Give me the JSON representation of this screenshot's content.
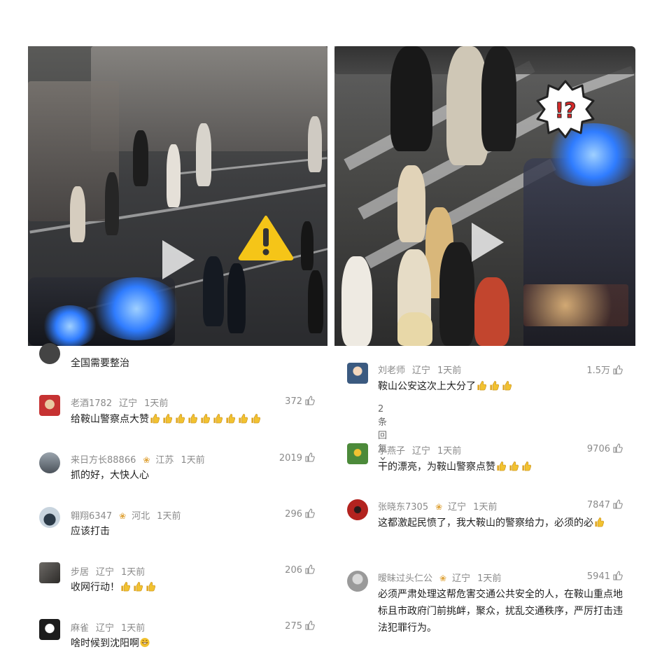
{
  "left_comments": [
    {
      "name": "",
      "location": "",
      "time": "",
      "text": "全国需要整治",
      "likes": "",
      "thumbs": 0
    },
    {
      "name": "老酒1782",
      "location": "辽宁",
      "time": "1天前",
      "text": "给鞍山警察点大赞",
      "likes": "372",
      "thumbs": 9
    },
    {
      "name": "来日方长88866",
      "location": "江苏",
      "time": "1天前",
      "text": "抓的好，大快人心",
      "likes": "2019",
      "thumbs": 0,
      "verified": true
    },
    {
      "name": "翱翔6347",
      "location": "河北",
      "time": "1天前",
      "text": "应该打击",
      "likes": "296",
      "thumbs": 0,
      "verified": true
    },
    {
      "name": "步居",
      "location": "辽宁",
      "time": "1天前",
      "text": "收网行动！",
      "likes": "206",
      "thumbs": 3
    },
    {
      "name": "麻雀",
      "location": "辽宁",
      "time": "1天前",
      "text": "啥时候到沈阳啊",
      "likes": "275",
      "thumbs": 0,
      "grin": true
    }
  ],
  "right_comments": [
    {
      "name": "刘老师",
      "location": "辽宁",
      "time": "1天前",
      "text": "鞍山公安这次上大分了",
      "likes": "1.5万",
      "thumbs": 3,
      "replies": "2条回复"
    },
    {
      "name": "小燕子",
      "location": "辽宁",
      "time": "1天前",
      "text": "干的漂亮，为鞍山警察点赞",
      "likes": "9706",
      "thumbs": 3
    },
    {
      "name": "张晓东7305",
      "location": "辽宁",
      "time": "1天前",
      "text": "这都激起民愤了，我大鞍山的警察给力，必须的必",
      "likes": "7847",
      "thumbs": 1,
      "verified": true
    },
    {
      "name": "暧昧过头仁公",
      "location": "辽宁",
      "time": "1天前",
      "text": "必须严肃处理这帮危害交通公共安全的人，在鞍山重点地标且市政府门前挑衅，聚众，扰乱交通秩序，严厉打击违法犯罪行为。",
      "likes": "5941",
      "thumbs": 0,
      "verified": true
    }
  ],
  "icons": {
    "like": "thumbs-up-icon",
    "play": "play-icon",
    "warning": "warning-icon",
    "exclaim": "shock-exclaim-icon",
    "chevron": "chevron-down-icon"
  },
  "colors": {
    "warning": "#f5c518",
    "thumb_emoji": "#f2c230",
    "verified": "#e0a640",
    "meta": "#8a8a8a"
  },
  "badge_text": {
    "shock": "!?"
  }
}
